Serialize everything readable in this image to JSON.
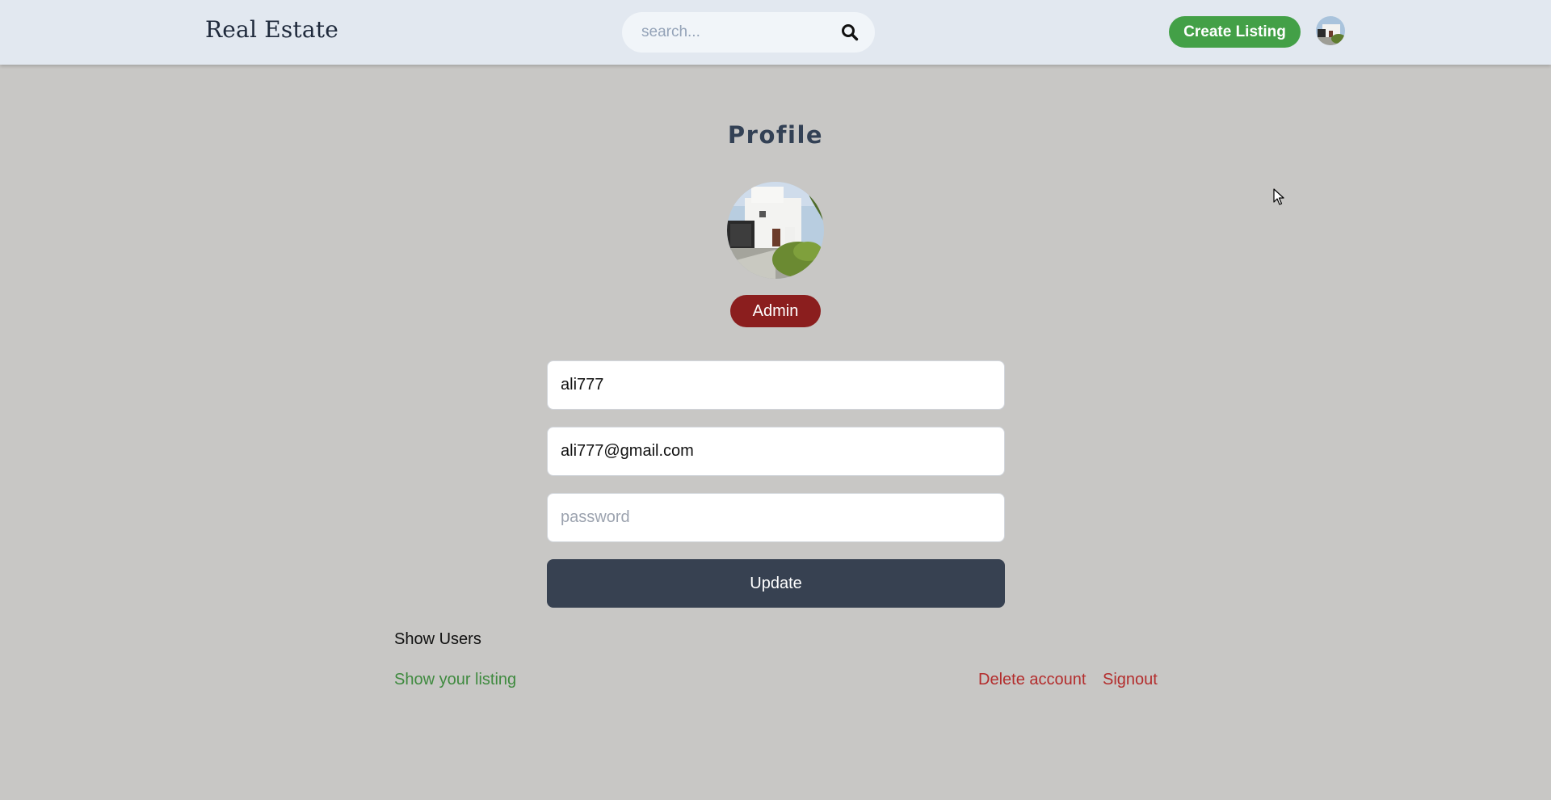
{
  "header": {
    "brand": "Real Estate",
    "search_placeholder": "search...",
    "create_listing_label": "Create Listing",
    "accent_color": "#43a047"
  },
  "profile": {
    "title": "Profile",
    "role_badge": "Admin",
    "username_value": "ali777",
    "email_value": "ali777@gmail.com",
    "password_placeholder": "password",
    "update_label": "Update",
    "badge_color": "#8b1e1e"
  },
  "actions": {
    "show_users": "Show Users",
    "show_listing": "Show your listing",
    "delete_account": "Delete account",
    "signout": "Signout"
  },
  "icons": {
    "search": "search-icon",
    "avatar": "house-photo"
  }
}
